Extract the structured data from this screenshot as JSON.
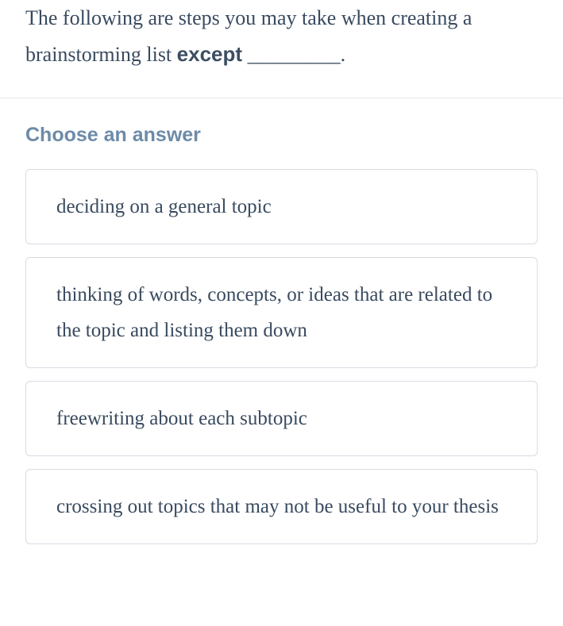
{
  "question": {
    "prefix": "The following are steps you may take when creating a brainstorming list ",
    "bold": "except",
    "suffix": " _________."
  },
  "choose_label": "Choose an answer",
  "options": [
    "deciding on a general topic",
    "thinking of words, concepts, or ideas that are related to the topic and listing them down",
    "freewriting about each subtopic",
    "crossing out topics that may not be useful to your thesis"
  ]
}
